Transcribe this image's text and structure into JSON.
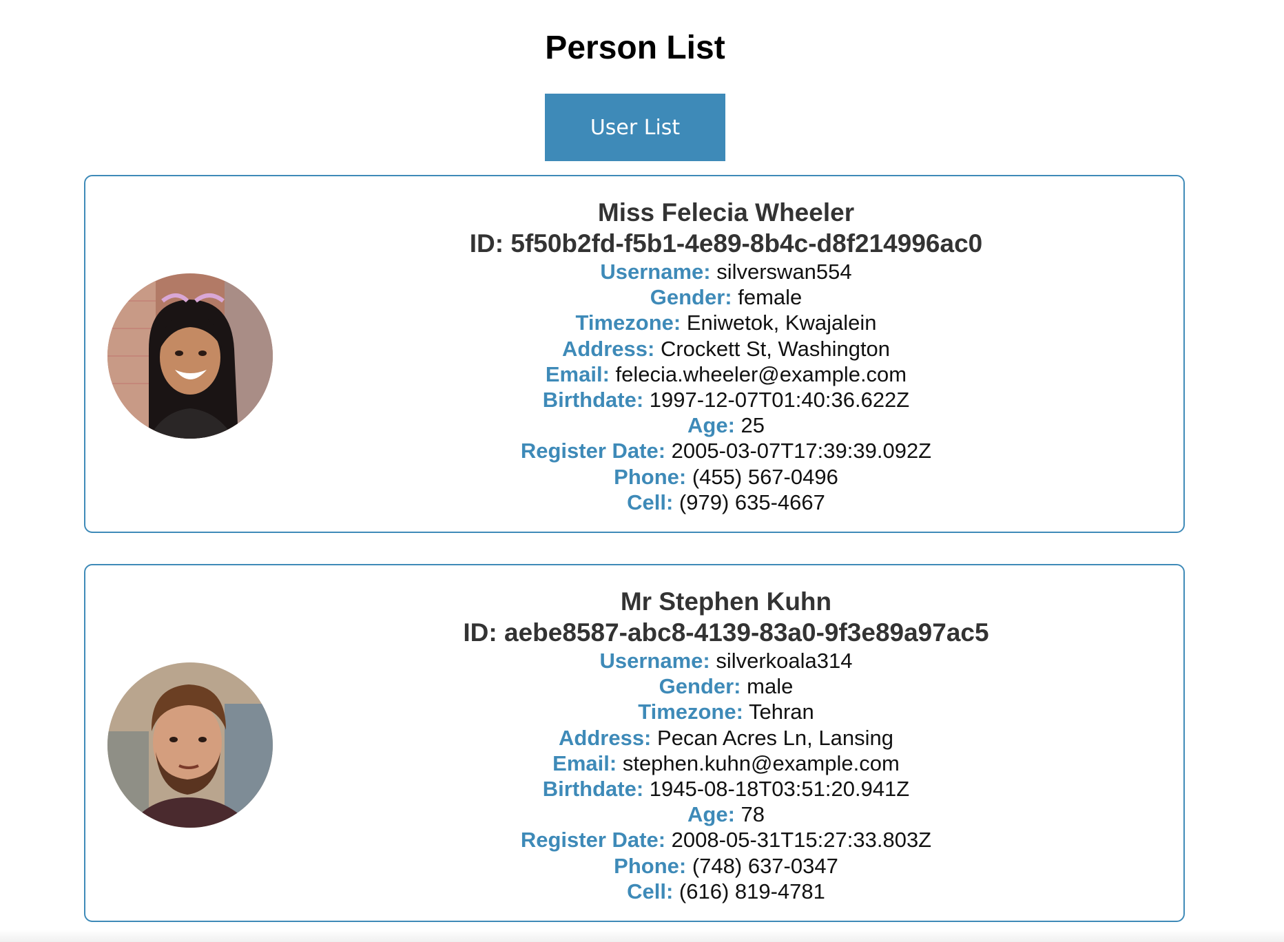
{
  "header": {
    "title": "Person List",
    "button_label": "User List"
  },
  "colors": {
    "accent": "#3e8ab8",
    "label": "#3e8ab8",
    "text": "#111111",
    "heading": "#333333"
  },
  "people": [
    {
      "name": "Miss Felecia Wheeler",
      "id_text": "ID: 5f50b2fd-f5b1-4e89-8b4c-d8f214996ac0",
      "avatar": "avatar-photo-woman-smiling-icon",
      "fields": [
        {
          "label": "Username:",
          "value": "silverswan554"
        },
        {
          "label": "Gender:",
          "value": "female"
        },
        {
          "label": "Timezone:",
          "value": "Eniwetok, Kwajalein"
        },
        {
          "label": "Address:",
          "value": "Crockett St, Washington"
        },
        {
          "label": "Email:",
          "value": "felecia.wheeler@example.com"
        },
        {
          "label": "Birthdate:",
          "value": "1997-12-07T01:40:36.622Z"
        },
        {
          "label": "Age:",
          "value": "25"
        },
        {
          "label": "Register Date:",
          "value": "2005-03-07T17:39:39.092Z"
        },
        {
          "label": "Phone:",
          "value": "(455) 567-0496"
        },
        {
          "label": "Cell:",
          "value": "(979) 635-4667"
        }
      ]
    },
    {
      "name": "Mr Stephen Kuhn",
      "id_text": "ID: aebe8587-abc8-4139-83a0-9f3e89a97ac5",
      "avatar": "avatar-photo-man-bearded-icon",
      "fields": [
        {
          "label": "Username:",
          "value": "silverkoala314"
        },
        {
          "label": "Gender:",
          "value": "male"
        },
        {
          "label": "Timezone:",
          "value": "Tehran"
        },
        {
          "label": "Address:",
          "value": "Pecan Acres Ln, Lansing"
        },
        {
          "label": "Email:",
          "value": "stephen.kuhn@example.com"
        },
        {
          "label": "Birthdate:",
          "value": "1945-08-18T03:51:20.941Z"
        },
        {
          "label": "Age:",
          "value": "78"
        },
        {
          "label": "Register Date:",
          "value": "2008-05-31T15:27:33.803Z"
        },
        {
          "label": "Phone:",
          "value": "(748) 637-0347"
        },
        {
          "label": "Cell:",
          "value": "(616) 819-4781"
        }
      ]
    }
  ]
}
